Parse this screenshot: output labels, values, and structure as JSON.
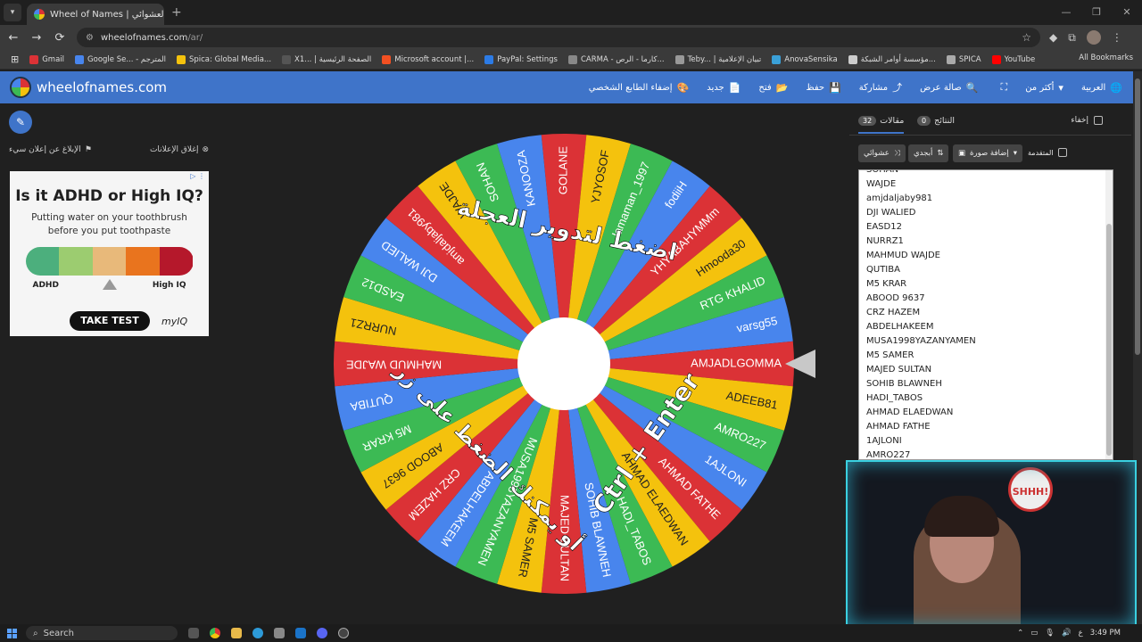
{
  "browser": {
    "tab_title": "Wheel of Names | عجلة الاسم العشوائي",
    "tab_close": "✕",
    "new_tab": "+",
    "url_host": "wheelofnames.com",
    "url_path": "/ar/"
  },
  "bookmarks": [
    {
      "label": "Gmail",
      "color": "#db3236"
    },
    {
      "label": "Google Se... - المترجم",
      "color": "#4885ed"
    },
    {
      "label": "Spica: Global Media...",
      "color": "#f4c20d"
    },
    {
      "label": "X1... | الصفحة الرئيسية",
      "color": "#555555"
    },
    {
      "label": "Microsoft account |...",
      "color": "#f25022"
    },
    {
      "label": "PayPal: Settings",
      "color": "#2c7be5"
    },
    {
      "label": "CARMA - كارما - الرص...",
      "color": "#888888"
    },
    {
      "label": "Teby... | تبيان الإعلامية",
      "color": "#999999"
    },
    {
      "label": "AnovaSensika",
      "color": "#3aa0d8"
    },
    {
      "label": "مؤسسة أوامر الشبكة...",
      "color": "#cccccc"
    },
    {
      "label": "SPICA",
      "color": "#aaaaaa"
    },
    {
      "label": "YouTube",
      "color": "#ff0000"
    }
  ],
  "all_bookmarks": "All Bookmarks",
  "app": {
    "brand": "wheelofnames.com",
    "menu": [
      {
        "label": "العربية",
        "icon": "🌐"
      },
      {
        "label": "أكثر من",
        "icon": "▾"
      },
      {
        "label": "",
        "icon": "⛶"
      },
      {
        "label": "صالة عرض",
        "icon": "🔍"
      },
      {
        "label": "مشاركة",
        "icon": "⤴"
      },
      {
        "label": "حفظ",
        "icon": "💾"
      },
      {
        "label": "فتح",
        "icon": "📂"
      },
      {
        "label": "جديد",
        "icon": "📄"
      },
      {
        "label": "إضفاء الطابع الشخصي",
        "icon": "🎨"
      }
    ]
  },
  "ads": {
    "report_label": "الإبلاغ عن إعلان سيء",
    "close_label": "إغلاق الإعلانات",
    "title": "Is it ADHD or High IQ?",
    "text_line1": "Putting water on your toothbrush",
    "text_line2": "before you put toothpaste",
    "label_left": "ADHD",
    "label_right": "High IQ",
    "cta": "TAKE TEST",
    "brand": "myIQ",
    "scale_colors": [
      "#4caf7d",
      "#9ccc70",
      "#e8b97a",
      "#e9741e",
      "#b5182b"
    ]
  },
  "wheel": {
    "colors": [
      "#db3236",
      "#f4c20d",
      "#3cba54",
      "#4885ed"
    ],
    "names": [
      "GOLANE",
      "YJYOSOF",
      "lamaman_1997",
      "fodiiH",
      "YHYABAHYMMm",
      "Hmooda30",
      "RTG KHALID",
      "varsg55",
      "AMJADLGOMMA",
      "ADEEB81",
      "AMRO227",
      "1AJLONI",
      "AHMAD FATHE",
      "AHMAD ELAEDWAN",
      "HADI_TABOS",
      "SOHIB BLAWNEH",
      "MAJED SULTAN",
      "M5 SAMER",
      "MUSA1998YAZANYAMEN",
      "ABDELHAKEEM",
      "CRZ HAZEM",
      "ABOOD 9637",
      "M5 KRAR",
      "QUTIBA",
      "MAHMUD WAJDE",
      "NURRZ1",
      "EASD12",
      "DJI WALIED",
      "amjdaljaby981",
      "WAJDE",
      "SOHAN",
      "KANOOZA"
    ],
    "top_text": "اضغط لتدوير العجلة",
    "bottom_text_1": "أو يمكنك الضغط على زر",
    "bottom_text_2": "Ctrl + Enter"
  },
  "panel": {
    "entries_tab": "مقالات",
    "entries_count": "32",
    "results_tab": "النتائج",
    "results_count": "0",
    "hide_label": "إخفاء",
    "shuffle_label": "عشوائي",
    "sort_label": "أبجدي",
    "add_image_label": "إضافة صورة",
    "advanced_label": "المتقدمة",
    "entries": [
      "SOHAN",
      "WAJDE",
      "amjdaljaby981",
      "DJI WALIED",
      "EASD12",
      "NURRZ1",
      "MAHMUD WAJDE",
      "QUTIBA",
      "M5 KRAR",
      "ABOOD 9637",
      "CRZ HAZEM",
      "ABDELHAKEEM",
      "MUSA1998YAZANYAMEN",
      "M5 SAMER",
      "MAJED SULTAN",
      "SOHIB BLAWNEH",
      "HADI_TABOS",
      "AHMAD ELAEDWAN",
      "AHMAD FATHE",
      "1AJLONI",
      "AMRO227"
    ]
  },
  "webcam": {
    "sign": "SHHH!"
  },
  "taskbar": {
    "search": "Search",
    "ime": "ع",
    "time": "3:49 PM"
  }
}
